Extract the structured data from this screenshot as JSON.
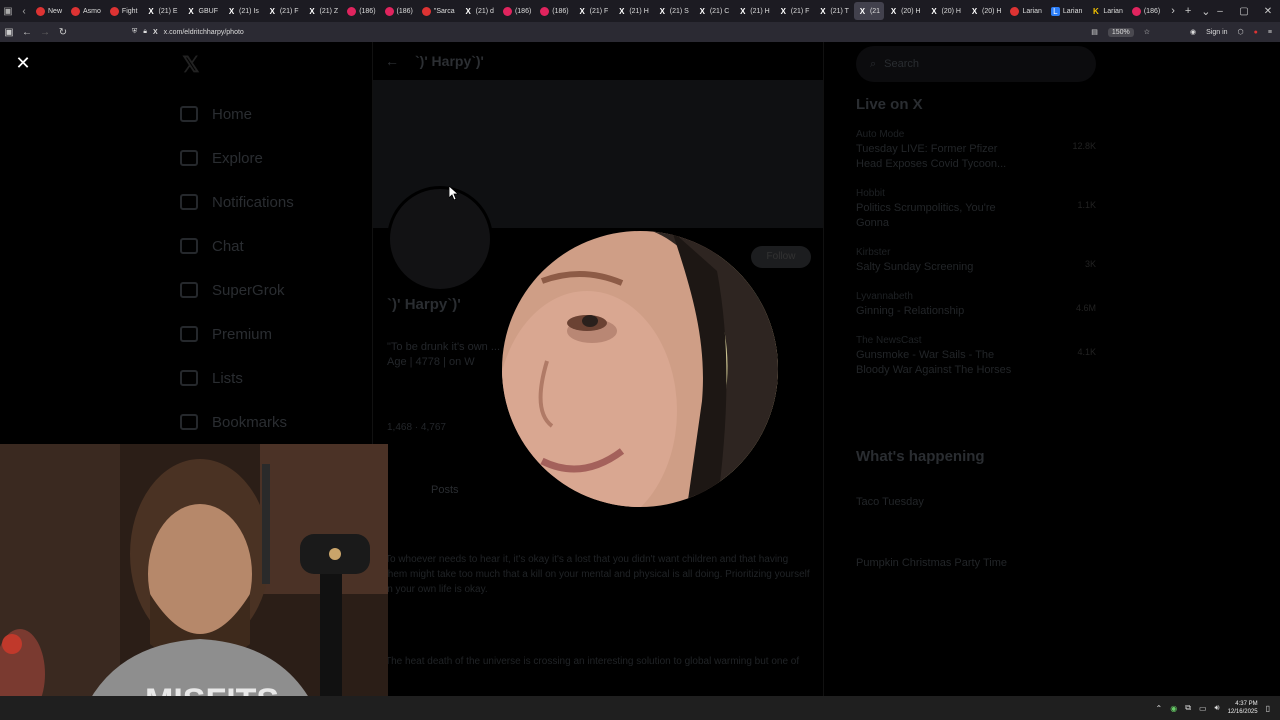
{
  "browser": {
    "tabs": [
      {
        "label": "New",
        "icon": "red"
      },
      {
        "label": "Asmo",
        "icon": "red"
      },
      {
        "label": "Fight",
        "icon": "red"
      },
      {
        "label": "(21) E",
        "icon": "x"
      },
      {
        "label": "GBUF",
        "icon": "x"
      },
      {
        "label": "(21) Is",
        "icon": "x"
      },
      {
        "label": "(21) F",
        "icon": "x"
      },
      {
        "label": "(21) Z",
        "icon": "x"
      },
      {
        "label": "(186)",
        "icon": "yt"
      },
      {
        "label": "(186)",
        "icon": "yt"
      },
      {
        "label": "\"Sarca",
        "icon": "red"
      },
      {
        "label": "(21) d",
        "icon": "x"
      },
      {
        "label": "(186)",
        "icon": "yt"
      },
      {
        "label": "(186)",
        "icon": "yt"
      },
      {
        "label": "(21) F",
        "icon": "x"
      },
      {
        "label": "(21) H",
        "icon": "x"
      },
      {
        "label": "(21) S",
        "icon": "x"
      },
      {
        "label": "(21) C",
        "icon": "x"
      },
      {
        "label": "(21) H",
        "icon": "x"
      },
      {
        "label": "(21) F",
        "icon": "x"
      },
      {
        "label": "(21) T",
        "icon": "x"
      },
      {
        "label": "(21",
        "icon": "x",
        "active": true
      },
      {
        "label": "(20) H",
        "icon": "x"
      },
      {
        "label": "(20) H",
        "icon": "x"
      },
      {
        "label": "(20) H",
        "icon": "x"
      },
      {
        "label": "Larian",
        "icon": "red"
      },
      {
        "label": "Larian",
        "icon": "li"
      },
      {
        "label": "Larian",
        "icon": "k"
      },
      {
        "label": "(186)",
        "icon": "yt"
      }
    ],
    "url": "x.com/eldritchharpy/photo",
    "zoom": "150%",
    "sign_in": "Sign in"
  },
  "page": {
    "nav": [
      "Home",
      "Explore",
      "Notifications",
      "Chat",
      "SuperGrok",
      "Premium",
      "Lists",
      "Bookmarks"
    ],
    "profile_name": "`)' Harpy`)'",
    "profile_header_name": "`)' Harpy`)'",
    "follow_label": "Follow",
    "bio_line1": "\"To be drunk it's own ...",
    "bio_line2": "Age | 4778 | on W",
    "stats": "1,468  ·  4,767",
    "tabs_label": "Posts",
    "post1": "To whoever needs to hear it, it's okay it's a lost that you didn't want children and that having them might take too much that a kill on your mental and physical is all doing. Prioritizing yourself in your own life is okay.",
    "post2": "The heat death of the universe is crossing an interesting solution to global warming but one of",
    "search_placeholder": "Search",
    "live_title": "Live on X",
    "live": [
      {
        "host": "Auto Mode",
        "text": "Tuesday LIVE: Former Pfizer Head Exposes Covid Tycoon...",
        "count": "12.8K"
      },
      {
        "host": "Hobbit",
        "text": "Politics Scrumpolitics, You're Gonna",
        "count": "1.1K"
      },
      {
        "host": "Kirbster",
        "text": "Salty Sunday Screening",
        "count": "3K"
      },
      {
        "host": "Lyvannabeth",
        "text": "Ginning - Relationship",
        "count": "4.6M"
      },
      {
        "host": "The NewsCast",
        "text": "Gunsmoke - War Sails - The Bloody War Against The Horses",
        "count": "4.1K"
      }
    ],
    "happening_title": "What's happening",
    "trend1": "Taco Tuesday",
    "trend2": "Pumpkin Christmas Party Time"
  },
  "modal": {
    "close_icon": "close-icon"
  },
  "taskbar": {
    "time": "4:37 PM",
    "date": "12/16/2025"
  }
}
